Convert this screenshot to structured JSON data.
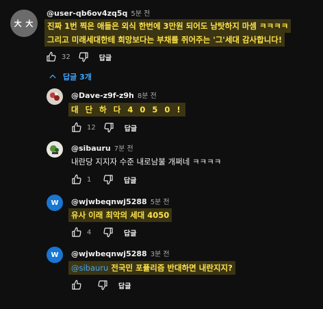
{
  "main_comment": {
    "avatar_text": "大 大",
    "author": "@user-qb6ov4zq5q",
    "time": "5분 전",
    "line1": "진짜 1번 찍은 애들은 외식 한번에 3만원 되어도 남탓하지 마셈 ㅋㅋㅋㅋ",
    "line2": "그리고 미래세대한테 희망보다는 부채를 쥐어주는 '그'세대 감사합니다!",
    "likes": "32",
    "reply_label": "답글"
  },
  "replies_toggle": {
    "label": "답글 3개"
  },
  "replies": [
    {
      "author": "@Dave-z9f-z9h",
      "time": "8분 전",
      "text": "대 단 하 다 4 0 5 0 !",
      "likes": "12",
      "reply_label": "답글"
    },
    {
      "author": "@sibauru",
      "time": "7분 전",
      "text": "내란당 지지자 수준 내로남불 개쩌네 ㅋㅋㅋㅋ",
      "likes": "1",
      "reply_label": "답글"
    },
    {
      "author": "@wjwbeqnwj5288",
      "time": "5분 전",
      "text": "유사 이래 최악의 세대 4050",
      "likes": "4",
      "reply_label": "답글",
      "avatar_letter": "W"
    },
    {
      "author": "@wjwbeqnwj5288",
      "time": "3분 전",
      "mention": "@sibauru",
      "text": "전국민 포퓰리즘 반대하면 내란지지?",
      "likes": "",
      "reply_label": "답글",
      "avatar_letter": "W"
    }
  ],
  "colors": {
    "background": "#0f0f0f",
    "highlight_bg": "#3c3513",
    "highlight_text": "#fde34a",
    "link_blue": "#3ea6ff"
  }
}
